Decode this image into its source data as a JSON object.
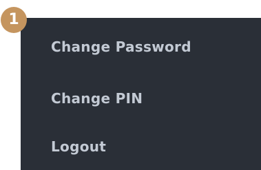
{
  "badge": {
    "number": "1",
    "color": "#c5955f"
  },
  "menu": {
    "background": "#2a2f37",
    "text_color": "#c3cad4",
    "items": [
      {
        "label": "Change Password"
      },
      {
        "label": "Change PIN"
      },
      {
        "label": "Logout"
      }
    ]
  }
}
